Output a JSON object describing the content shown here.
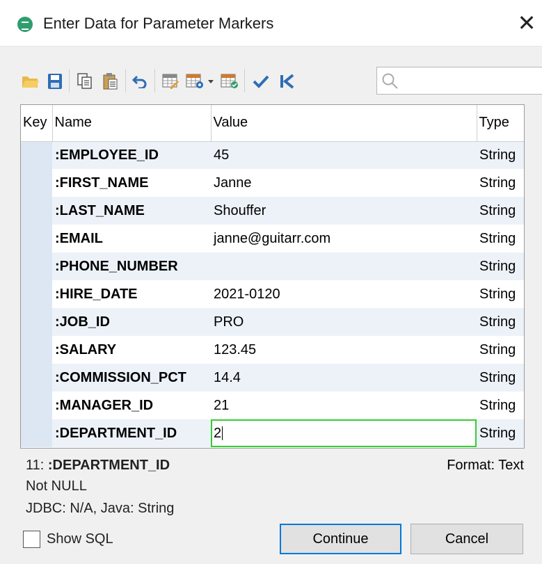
{
  "window": {
    "title": "Enter Data for Parameter Markers",
    "close_glyph": "✕",
    "app_icon": "database-params-icon",
    "accent_color": "#2f9e6e"
  },
  "toolbar": {
    "icons": [
      "open-folder-icon",
      "save-icon",
      "copy-icon",
      "paste-icon",
      "undo-icon",
      "grid-edit-icon",
      "grid-settings-icon",
      "dropdown-arrow-icon",
      "grid-check-icon",
      "checkmark-icon",
      "first-record-icon",
      "search-icon"
    ],
    "search_value": ""
  },
  "grid": {
    "columns": [
      "Key",
      "Name",
      "Value",
      "Type"
    ],
    "rows": [
      {
        "key": "",
        "name": ":EMPLOYEE_ID",
        "value": "45",
        "type": "String"
      },
      {
        "key": "",
        "name": ":FIRST_NAME",
        "value": "Janne",
        "type": "String"
      },
      {
        "key": "",
        "name": ":LAST_NAME",
        "value": "Shouffer",
        "type": "String"
      },
      {
        "key": "",
        "name": ":EMAIL",
        "value": "janne@guitarr.com",
        "type": "String"
      },
      {
        "key": "",
        "name": ":PHONE_NUMBER",
        "value": "",
        "type": "String"
      },
      {
        "key": "",
        "name": ":HIRE_DATE",
        "value": "2021-0120",
        "type": "String"
      },
      {
        "key": "",
        "name": ":JOB_ID",
        "value": "PRO",
        "type": "String"
      },
      {
        "key": "",
        "name": ":SALARY",
        "value": "123.45",
        "type": "String"
      },
      {
        "key": "",
        "name": ":COMMISSION_PCT",
        "value": "14.4",
        "type": "String"
      },
      {
        "key": "",
        "name": ":MANAGER_ID",
        "value": "21",
        "type": "String"
      },
      {
        "key": "",
        "name": ":DEPARTMENT_ID",
        "value": "2",
        "type": "String"
      }
    ],
    "editing_row": 10,
    "edit_border_color": "#33cc33"
  },
  "info": {
    "index_prefix": "11: ",
    "param_name": ":DEPARTMENT_ID",
    "nullability": "Not NULL",
    "type_info": "JDBC: N/A, Java: String",
    "format": "Format: Text"
  },
  "footer": {
    "show_sql_label": "Show SQL",
    "show_sql_checked": false,
    "continue_label": "Continue",
    "cancel_label": "Cancel"
  }
}
